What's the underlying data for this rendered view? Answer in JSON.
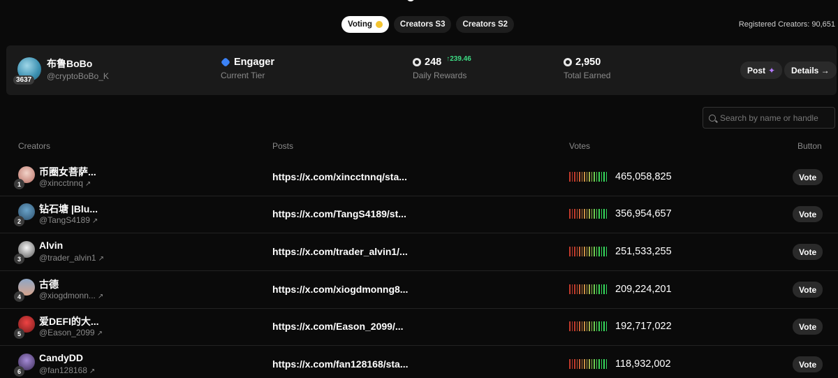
{
  "tabs": [
    {
      "label": "Voting",
      "active": true
    },
    {
      "label": "Creators S3",
      "active": false
    },
    {
      "label": "Creators S2",
      "active": false
    }
  ],
  "registered": "Registered Creators: 90,651",
  "profile": {
    "name": "布鲁BoBo",
    "handle": "@cryptoBoBo_K",
    "badge": "3637",
    "tier_value": "Engager",
    "tier_label": "Current Tier",
    "daily_value": "248",
    "daily_delta": "239.46",
    "daily_label": "Daily Rewards",
    "total_value": "2,950",
    "total_label": "Total Earned",
    "post_label": "Post",
    "details_label": "Details →"
  },
  "search": {
    "placeholder": "Search by name or handle"
  },
  "table": {
    "headers": {
      "creators": "Creators",
      "posts": "Posts",
      "votes": "Votes",
      "button": "Button"
    },
    "rows": [
      {
        "rank": "1",
        "name": "币圈女菩萨...",
        "handle": "@xincctnnq",
        "post": "https://x.com/xincctnnq/sta...",
        "votes": "465,058,825",
        "vote": "Vote"
      },
      {
        "rank": "2",
        "name": "钻石塘 |Blu...",
        "handle": "@TangS4189",
        "post": "https://x.com/TangS4189/st...",
        "votes": "356,954,657",
        "vote": "Vote"
      },
      {
        "rank": "3",
        "name": "Alvin",
        "handle": "@trader_alvin1",
        "post": "https://x.com/trader_alvin1/...",
        "votes": "251,533,255",
        "vote": "Vote"
      },
      {
        "rank": "4",
        "name": "古德",
        "handle": "@xiogdmonn...",
        "post": "https://x.com/xiogdmonng8...",
        "votes": "209,224,201",
        "vote": "Vote"
      },
      {
        "rank": "5",
        "name": "爱DEFI的大...",
        "handle": "@Eason_2099",
        "post": "https://x.com/Eason_2099/...",
        "votes": "192,717,022",
        "vote": "Vote"
      },
      {
        "rank": "6",
        "name": "CandyDD",
        "handle": "@fan128168",
        "post": "https://x.com/fan128168/sta...",
        "votes": "118,932,002",
        "vote": "Vote"
      }
    ]
  },
  "colors": {
    "accent_green": "#3ddc84",
    "tier_blue": "#3b82f6",
    "bg": "#0a0a0a"
  }
}
